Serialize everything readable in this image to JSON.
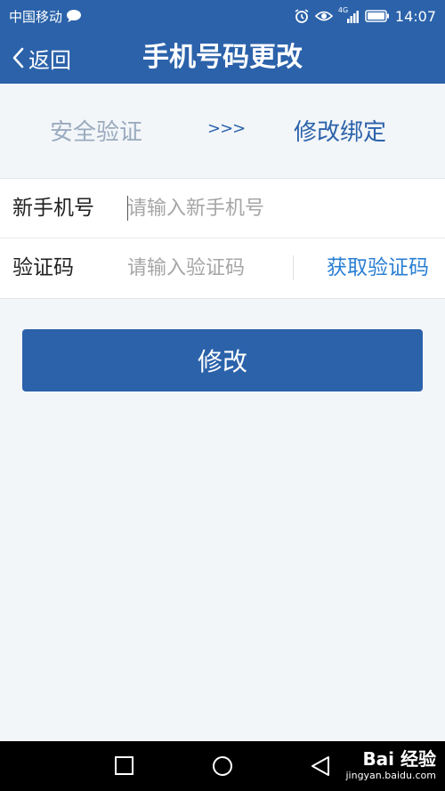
{
  "status_bar": {
    "carrier": "中国移动",
    "network": "4G",
    "time": "14:07",
    "icons": [
      "chat-icon",
      "alarm-icon",
      "eye-icon",
      "signal-icon",
      "battery-icon"
    ]
  },
  "nav": {
    "back_label": "返回",
    "title": "手机号码更改"
  },
  "steps": {
    "step1": "安全验证",
    "arrows": ">>>",
    "step2": "修改绑定"
  },
  "form": {
    "phone_label": "新手机号",
    "phone_placeholder": "请输入新手机号",
    "phone_value": "",
    "code_label": "验证码",
    "code_placeholder": "请输入验证码",
    "code_value": "",
    "get_code_label": "获取验证码"
  },
  "submit_label": "修改",
  "system_nav": {
    "icons": [
      "recent-apps-icon",
      "home-icon",
      "back-triangle-icon"
    ]
  },
  "watermark": {
    "logo": "Bai 经验",
    "site": "jingyan.baidu.com"
  },
  "colors": {
    "primary": "#2b62aa",
    "link": "#2a7fd4",
    "background": "#f3f6f9",
    "inactive_step": "#9aabbf"
  }
}
